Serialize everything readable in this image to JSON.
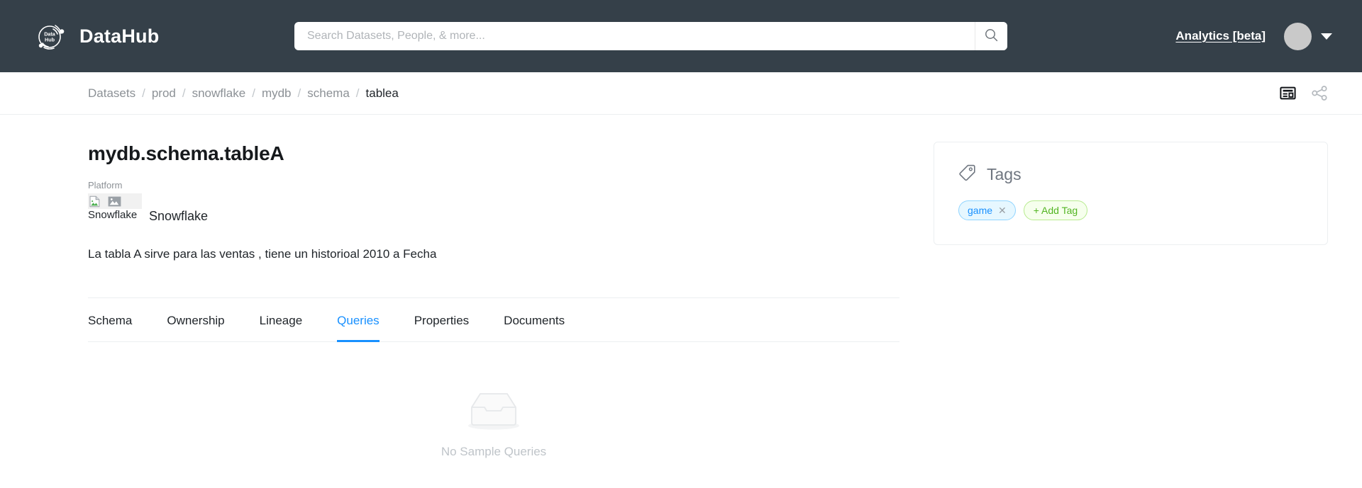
{
  "header": {
    "brand_name": "DataHub",
    "logo_icon": "datahub-orbit-logo",
    "logo_text_line1": "Data",
    "logo_text_line2": "Hub",
    "search": {
      "placeholder": "Search Datasets, People, & more...",
      "value": "",
      "icon": "search-icon"
    },
    "analytics_link": "Analytics [beta]",
    "avatar_icon": "user-avatar",
    "caret_icon": "chevron-down-icon",
    "background_color": "#354049"
  },
  "breadcrumb": {
    "separator": "/",
    "items": [
      {
        "label": "Datasets",
        "current": false
      },
      {
        "label": "prod",
        "current": false
      },
      {
        "label": "snowflake",
        "current": false
      },
      {
        "label": "mydb",
        "current": false
      },
      {
        "label": "schema",
        "current": false
      },
      {
        "label": "tablea",
        "current": true
      }
    ],
    "actions": [
      {
        "icon": "card-layout-icon",
        "name": "view-toggle"
      },
      {
        "icon": "share-icon",
        "name": "share"
      }
    ]
  },
  "entity": {
    "title": "mydb.schema.tableA",
    "platform_label": "Platform",
    "platform_logo_alt": "Snowflake",
    "platform_name": "Snowflake",
    "description": "La tabla A sirve para las ventas , tiene un historioal 2010 a Fecha"
  },
  "tabs": {
    "items": [
      {
        "label": "Schema",
        "active": false
      },
      {
        "label": "Ownership",
        "active": false
      },
      {
        "label": "Lineage",
        "active": false
      },
      {
        "label": "Queries",
        "active": true
      },
      {
        "label": "Properties",
        "active": false
      },
      {
        "label": "Documents",
        "active": false
      }
    ],
    "active_color": "#1890ff"
  },
  "tags_card": {
    "icon": "tag-icon",
    "title": "Tags",
    "tags": [
      {
        "label": "game",
        "remove_icon": "close-icon",
        "color": "#1890ff"
      }
    ],
    "add_tag_label": "+ Add Tag",
    "add_tag_color": "#52b522"
  },
  "empty_state": {
    "icon": "empty-inbox-icon",
    "message": "No Sample Queries"
  }
}
